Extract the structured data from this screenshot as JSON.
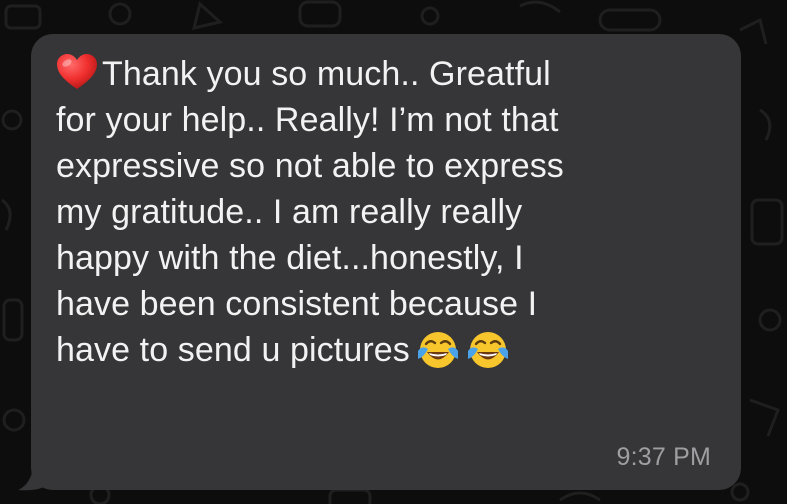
{
  "message": {
    "lead_icon": "red-heart-icon",
    "lines": [
      "Thank you so much.. Greatful",
      "for your help.. Really! I’m not that",
      "expressive so not able to express",
      "my gratitude.. I am really really",
      "happy with the diet...honestly, I",
      "have been consistent because I",
      "have to send u pictures"
    ],
    "trailing_icons": [
      "face-with-tears-of-joy-icon",
      "face-with-tears-of-joy-icon"
    ],
    "time": "9:37 PM"
  },
  "colors": {
    "bubble": "#363638",
    "text": "#f2f2f2",
    "timestamp": "#9e9ea3",
    "background": "#0d0d0d"
  }
}
